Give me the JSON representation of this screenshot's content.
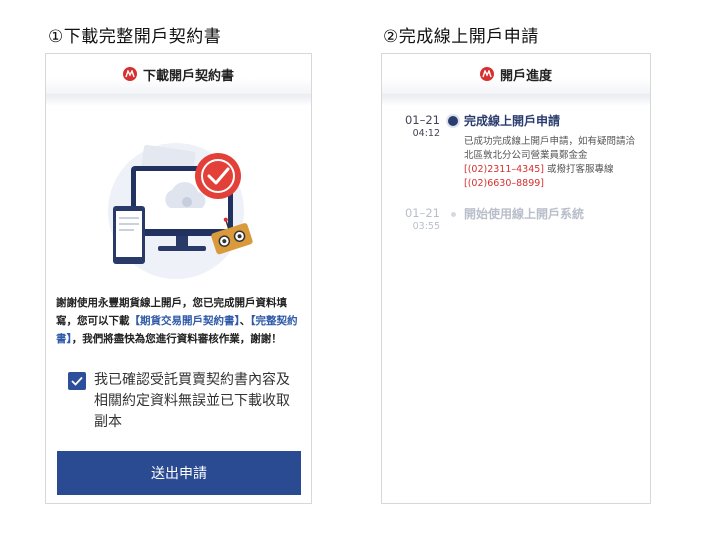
{
  "steps": [
    {
      "title": "①下載完整開戶契約書"
    },
    {
      "title": "②完成線上開戶申請"
    }
  ],
  "screen1": {
    "header_title": "下載開戶契約書",
    "thanks_part1": "謝謝使用永豐期貨線上開戶，您已完成開戶資料填寫，您可以下載",
    "link1": "【期貨交易開戶契約書】",
    "separator": "、",
    "link2": "【完整契約書】",
    "thanks_part2": "，我們將盡快為您進行資料審核作業，謝謝！",
    "agree_checked": true,
    "agree_text": "我已確認受託買賣契約書內容及相關約定資料無誤並已下載收取副本",
    "submit_label": "送出申請"
  },
  "screen2": {
    "header_title": "開戶進度",
    "timeline": [
      {
        "date": "01–21",
        "time": "04:12",
        "title": "完成線上開戶申請",
        "desc_part1": "已成功完成線上開戶申請，如有疑問請洽北區敦北分公司營業員鄭金金",
        "phone1": "[(02)2311–4345]",
        "desc_part2": " 或撥打客服專線",
        "phone2": "[(02)6630–8899]"
      },
      {
        "date": "01–21",
        "time": "03:55",
        "title": "開始使用線上開戶系統"
      }
    ]
  },
  "colors": {
    "brand_red": "#d6302f",
    "primary_blue": "#2a4a92",
    "link_blue": "#2f5aa8"
  }
}
